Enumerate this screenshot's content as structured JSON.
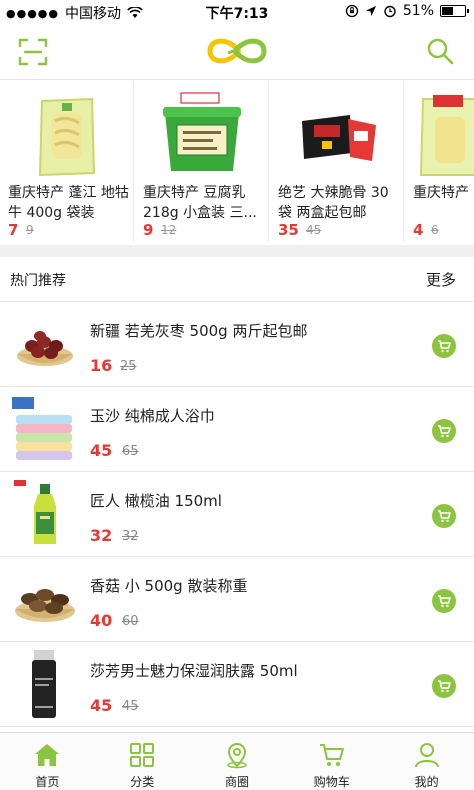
{
  "status_bar": {
    "signal_dots": "●●●●●",
    "carrier": "中国移动",
    "time": "下午7:13",
    "battery_percent": "51%",
    "battery_level": 0.51,
    "icons": [
      "wifi-icon",
      "rotation-lock-icon",
      "location-icon",
      "alarm-icon",
      "battery-icon"
    ]
  },
  "nav": {
    "left_icon": "scan-icon",
    "logo": "logo-icon",
    "right_icon": "search-icon",
    "accent_color": "#8bc53f",
    "logo_colors": [
      "#8bc53f",
      "#f5c400"
    ]
  },
  "featured": [
    {
      "title": "重庆特产 蓬江 地牯牛 400g 袋装",
      "price": "7",
      "old_price": "9"
    },
    {
      "title": "重庆特产 豆腐乳 218g 小盒装 三...",
      "price": "9",
      "old_price": "12"
    },
    {
      "title": "绝艺 大辣脆骨 30袋 两盒起包邮",
      "price": "35",
      "old_price": "45"
    },
    {
      "title": "重庆特产 珠 风味泡",
      "price": "4",
      "old_price": "6"
    }
  ],
  "section": {
    "title": "热门推荐",
    "more": "更多"
  },
  "products": [
    {
      "name": "新疆 若羌灰枣 500g 两斤起包邮",
      "price": "16",
      "old_price": "25"
    },
    {
      "name": "玉沙 纯棉成人浴巾",
      "price": "45",
      "old_price": "65"
    },
    {
      "name": "匠人 橄榄油 150ml",
      "price": "32",
      "old_price": "32"
    },
    {
      "name": "香菇 小 500g 散装称重",
      "price": "40",
      "old_price": "60"
    },
    {
      "name": "莎芳男士魅力保湿润肤露 50ml",
      "price": "45",
      "old_price": "45"
    }
  ],
  "tabs": [
    {
      "label": "首页",
      "icon": "home-icon",
      "active": true
    },
    {
      "label": "分类",
      "icon": "category-grid-icon",
      "active": false
    },
    {
      "label": "商圈",
      "icon": "location-pin-icon",
      "active": false
    },
    {
      "label": "购物车",
      "icon": "cart-icon",
      "active": false
    },
    {
      "label": "我的",
      "icon": "user-icon",
      "active": false
    }
  ]
}
